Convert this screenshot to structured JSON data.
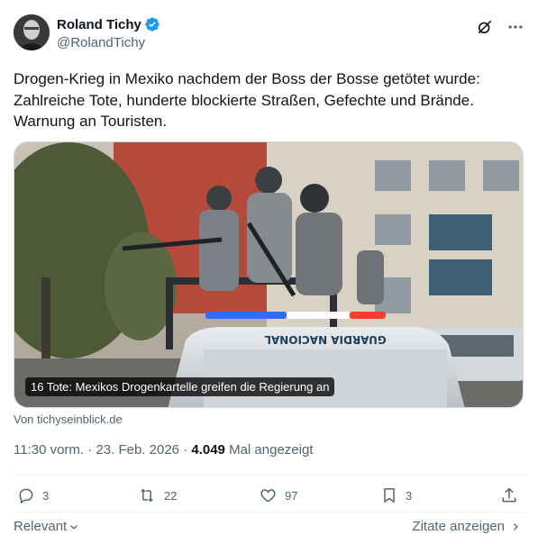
{
  "author": {
    "display_name": "Roland Tichy",
    "handle": "@RolandTichy",
    "verified": true
  },
  "tweet": {
    "text": "Drogen-Krieg in Mexiko nachdem der Boss der Bosse getötet wurde: Zahlreiche Tote, hunderte blockierte Straßen, Gefechte und Brände. Warnung an Touristen."
  },
  "card": {
    "caption": "16 Tote: Mexikos Drogenkartelle greifen die Regierung an",
    "vehicle_text": "GUARDIA NACIONAL",
    "source": "Von tichyseinblick.de"
  },
  "meta": {
    "time": "11:30 vorm.",
    "date": "23. Feb. 2026",
    "views": "4.049",
    "views_label": "Mal angezeigt",
    "sep": "·"
  },
  "actions": {
    "replies": "3",
    "reposts": "22",
    "likes": "97",
    "bookmarks": "3"
  },
  "footer": {
    "relevant": "Relevant",
    "quotes": "Zitate anzeigen"
  },
  "colors": {
    "verified_blue": "#1d9bf0",
    "secondary_text": "#536471",
    "primary_text": "#0f1419"
  },
  "icons": [
    "verified-badge-icon",
    "grok-icon",
    "more-icon",
    "reply-icon",
    "repost-icon",
    "like-icon",
    "bookmark-icon",
    "share-icon",
    "chevron-down-icon",
    "chevron-right-icon"
  ]
}
